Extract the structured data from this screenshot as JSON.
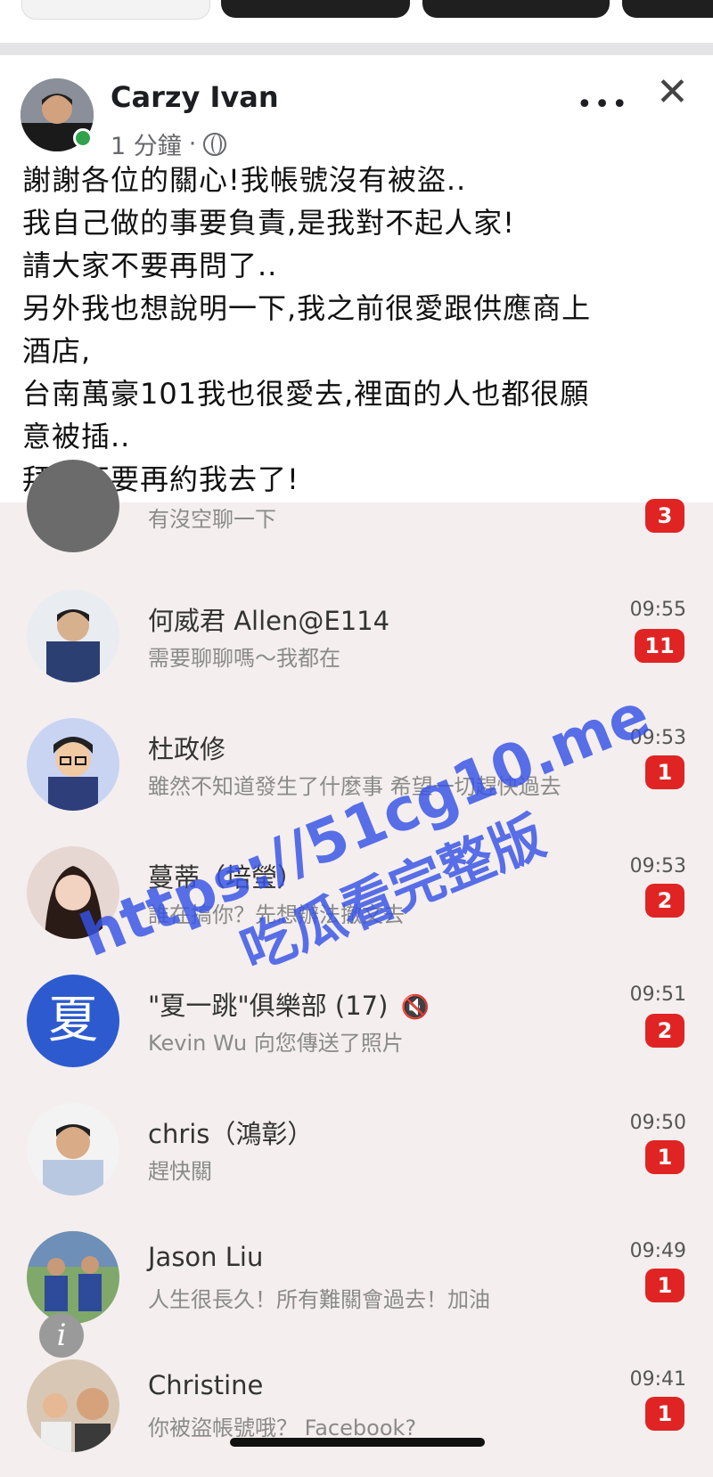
{
  "post": {
    "author": "Carzy Ivan",
    "time": "1 分鐘",
    "separator": "·",
    "more": "•••",
    "close": "✕",
    "lines": [
      "謝謝各位的關心!我帳號沒有被盜..",
      "我自己做的事要負責,是我對不起人家!",
      "請大家不要再問了..",
      "另外我也想說明一下,我之前很愛跟供應商上",
      "酒店,",
      "台南萬豪101我也很愛去,裡面的人也都很願",
      "意被插..",
      "拜託不要再約我去了!"
    ]
  },
  "chats": [
    {
      "name": "",
      "preview": "有沒空聊一下",
      "time": "",
      "badge": "3"
    },
    {
      "name": "何威君 Allen@E114",
      "preview": "需要聊聊嗎～我都在",
      "time": "09:55",
      "badge": "11"
    },
    {
      "name": "杜政修",
      "preview": "雖然不知道發生了什麼事 希望一切趕快過去",
      "time": "09:53",
      "badge": "1"
    },
    {
      "name": "蔓蒂（培瑩）",
      "preview": "誰在搞你？先想辦法撤文去",
      "time": "09:53",
      "badge": "2"
    },
    {
      "name": "\"夏一跳\"俱樂部 (17)",
      "preview": "Kevin Wu 向您傳送了照片",
      "time": "09:51",
      "badge": "2",
      "avatar_text": "夏"
    },
    {
      "name": "chris（鴻彰）",
      "preview": "趕快關",
      "time": "09:50",
      "badge": "1"
    },
    {
      "name": "Jason Liu",
      "preview": "人生很長久！所有難關會過去！加油",
      "time": "09:49",
      "badge": "1"
    },
    {
      "name": "Christine",
      "preview": "你被盜帳號哦？ Facebook?",
      "time": "09:41",
      "badge": "1"
    }
  ],
  "mute_icon": "🔇",
  "watermark": {
    "line1": "https://51cg10.me",
    "line2": "吃瓜看完整版"
  },
  "info_icon": "i",
  "colors": {
    "badge": "#e02424",
    "watermark": "#3553e6",
    "online": "#31a24c"
  }
}
